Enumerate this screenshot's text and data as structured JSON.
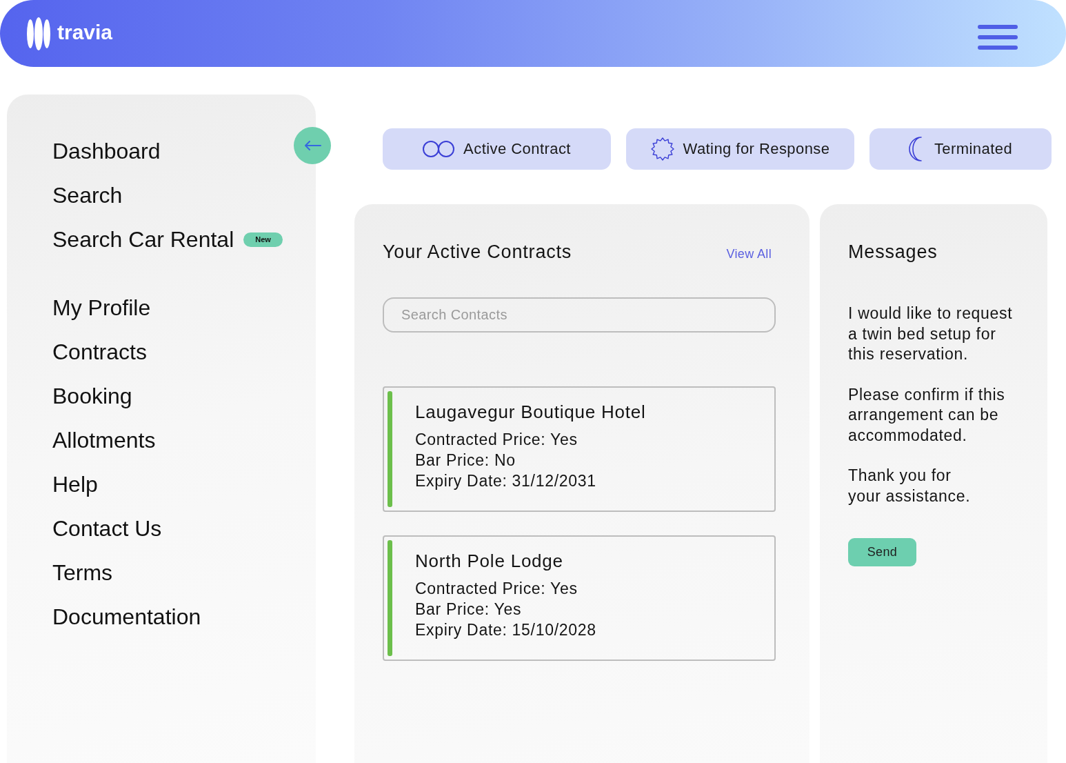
{
  "header": {
    "brand": "travia"
  },
  "sidebar": {
    "groups": [
      {
        "items": [
          {
            "label": "Dashboard"
          },
          {
            "label": "Search"
          },
          {
            "label": "Search Car Rental",
            "badge": "New"
          }
        ]
      },
      {
        "items": [
          {
            "label": "My Profile"
          },
          {
            "label": "Contracts"
          },
          {
            "label": "Booking"
          },
          {
            "label": "Allotments"
          },
          {
            "label": "Help"
          },
          {
            "label": "Contact Us"
          },
          {
            "label": "Terms"
          },
          {
            "label": "Documentation"
          }
        ]
      }
    ]
  },
  "status_tabs": [
    {
      "kind": "active",
      "label": "Active Contract"
    },
    {
      "kind": "waiting",
      "label": "Wating for Response"
    },
    {
      "kind": "terminated",
      "label": "Terminated"
    }
  ],
  "contracts_panel": {
    "title": "Your Active Contracts",
    "view_all": "View All",
    "search": {
      "placeholder": "Search Contacts"
    },
    "contracts": [
      {
        "name": "Laugavegur Boutique Hotel",
        "details": [
          "Contracted Price: Yes",
          "Bar Price: No",
          "Expiry Date: 31/12/2031"
        ]
      },
      {
        "name": "North Pole Lodge",
        "details": [
          "Contracted Price: Yes",
          "Bar Price: Yes",
          "Expiry Date: 15/10/2028"
        ]
      }
    ]
  },
  "messages_panel": {
    "title": "Messages",
    "paragraphs": [
      "I would like to request a twin bed setup for this reservation.",
      "Please confirm if this arrangement can be accommodated.",
      "Thank you for\nyour assistance."
    ],
    "send_button": "Send"
  }
}
